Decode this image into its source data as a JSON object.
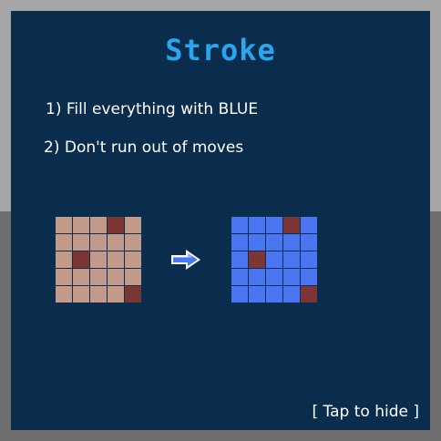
{
  "title": "Stroke",
  "steps": [
    "1) Fill everything with BLUE",
    "2) Don't run out of moves"
  ],
  "hide_label": "[ Tap to hide ]",
  "colors": {
    "tile": "#c49a8b",
    "obstacle": "#7c3636",
    "blue": "#4a76f1",
    "title": "#2ba6ee",
    "panel": "#0a2d4d"
  },
  "before_grid": [
    [
      "tile",
      "tile",
      "tile",
      "obstacle",
      "tile"
    ],
    [
      "tile",
      "tile",
      "tile",
      "tile",
      "tile"
    ],
    [
      "tile",
      "obstacle",
      "tile",
      "tile",
      "tile"
    ],
    [
      "tile",
      "tile",
      "tile",
      "tile",
      "tile"
    ],
    [
      "tile",
      "tile",
      "tile",
      "tile",
      "obstacle"
    ]
  ],
  "after_grid": [
    [
      "blue",
      "blue",
      "blue",
      "obstacle",
      "blue"
    ],
    [
      "blue",
      "blue",
      "blue",
      "blue",
      "blue"
    ],
    [
      "blue",
      "obstacle",
      "blue",
      "blue",
      "blue"
    ],
    [
      "blue",
      "blue",
      "blue",
      "blue",
      "blue"
    ],
    [
      "blue",
      "blue",
      "blue",
      "blue",
      "obstacle"
    ]
  ],
  "arrow_icon": "arrow-right-icon"
}
